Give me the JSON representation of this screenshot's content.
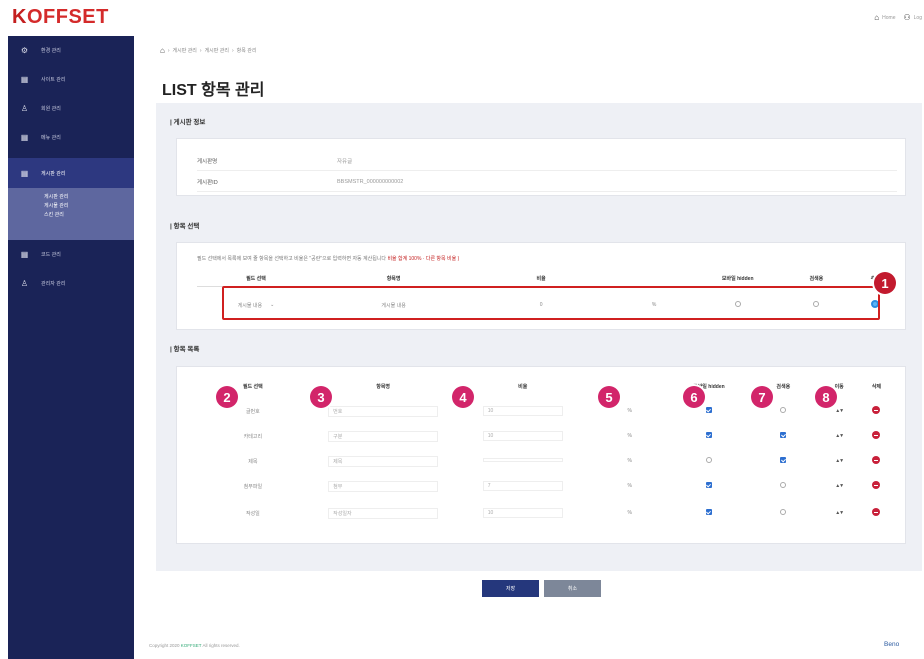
{
  "brand": {
    "logo_first": "K",
    "logo_rest": "OFFSET",
    "color": "#c42020"
  },
  "top_nav": {
    "home_label": "Home",
    "logout_label": "Log"
  },
  "sidebar": {
    "bg_color": "#1a2357",
    "items": [
      {
        "icon": "gear-icon",
        "label": "환경 관리"
      },
      {
        "icon": "grid-icon",
        "label": "사이트 관리"
      },
      {
        "icon": "user-icon",
        "label": "회원 관리"
      },
      {
        "icon": "grid-icon",
        "label": "메뉴 관리"
      },
      {
        "icon": "grid-icon",
        "label": "게시판 관리"
      },
      {
        "icon": "grid-icon",
        "label": "코드 관리"
      },
      {
        "icon": "user-icon",
        "label": "관리자 관리"
      }
    ],
    "sub_items": [
      "게시판 관리",
      "게시물 관리",
      "스킨 관리"
    ]
  },
  "breadcrumb": [
    "게시판 관리",
    "게시판 관리",
    "항목 관리"
  ],
  "page": {
    "title": "LIST 항목 관리"
  },
  "board_info": {
    "section_title": "| 게시판 정보",
    "rows": [
      {
        "label": "게시판명",
        "value": "자유글"
      },
      {
        "label": "게시판ID",
        "value": "BBSMSTR_000000000002"
      }
    ]
  },
  "item_select": {
    "section_title": "| 항목 선택",
    "notice": "필드 선택에서 목록에 보여 줄 항목을 선택하고 비율은 \"공란\"으로 입력하면 자동 계산됩니다",
    "notice_red": "비율 합계 100% · 다른 항목 비율 )",
    "headers": [
      "필드 선택",
      "항목명",
      "비율",
      "모바일 hidden",
      "검색용",
      "추가"
    ],
    "row": {
      "field": "게시물 내용",
      "name": "게시물 내용",
      "ratio": "0",
      "unit": "%"
    }
  },
  "item_list": {
    "section_title": "| 항목 목록",
    "headers": [
      "필드 선택",
      "항목명",
      "비율",
      "모바일 hidden",
      "검색용",
      "이동",
      "삭제"
    ],
    "rows": [
      {
        "field": "글번호",
        "name": "번호",
        "ratio": "10",
        "unit": "%",
        "mobile_hidden": true,
        "searchable": false
      },
      {
        "field": "카테고리",
        "name": "구분",
        "ratio": "10",
        "unit": "%",
        "mobile_hidden": true,
        "searchable": true
      },
      {
        "field": "제목",
        "name": "제목",
        "ratio": "",
        "unit": "%",
        "mobile_hidden": false,
        "searchable": true
      },
      {
        "field": "첨부파일",
        "name": "첨부",
        "ratio": "7",
        "unit": "%",
        "mobile_hidden": true,
        "searchable": false
      },
      {
        "field": "작성일",
        "name": "작성일자",
        "ratio": "10",
        "unit": "%",
        "mobile_hidden": true,
        "searchable": false
      }
    ],
    "sort_glyph": "▲▼"
  },
  "callouts": [
    "1",
    "2",
    "3",
    "4",
    "5",
    "6",
    "7",
    "8"
  ],
  "buttons": {
    "save": "저장",
    "cancel": "취소"
  },
  "footer": {
    "copyright_prefix": "Copyright 2020",
    "copyright_brand": "KOFFSET",
    "copyright_suffix": "All rights reserved.",
    "right": "Beno"
  }
}
